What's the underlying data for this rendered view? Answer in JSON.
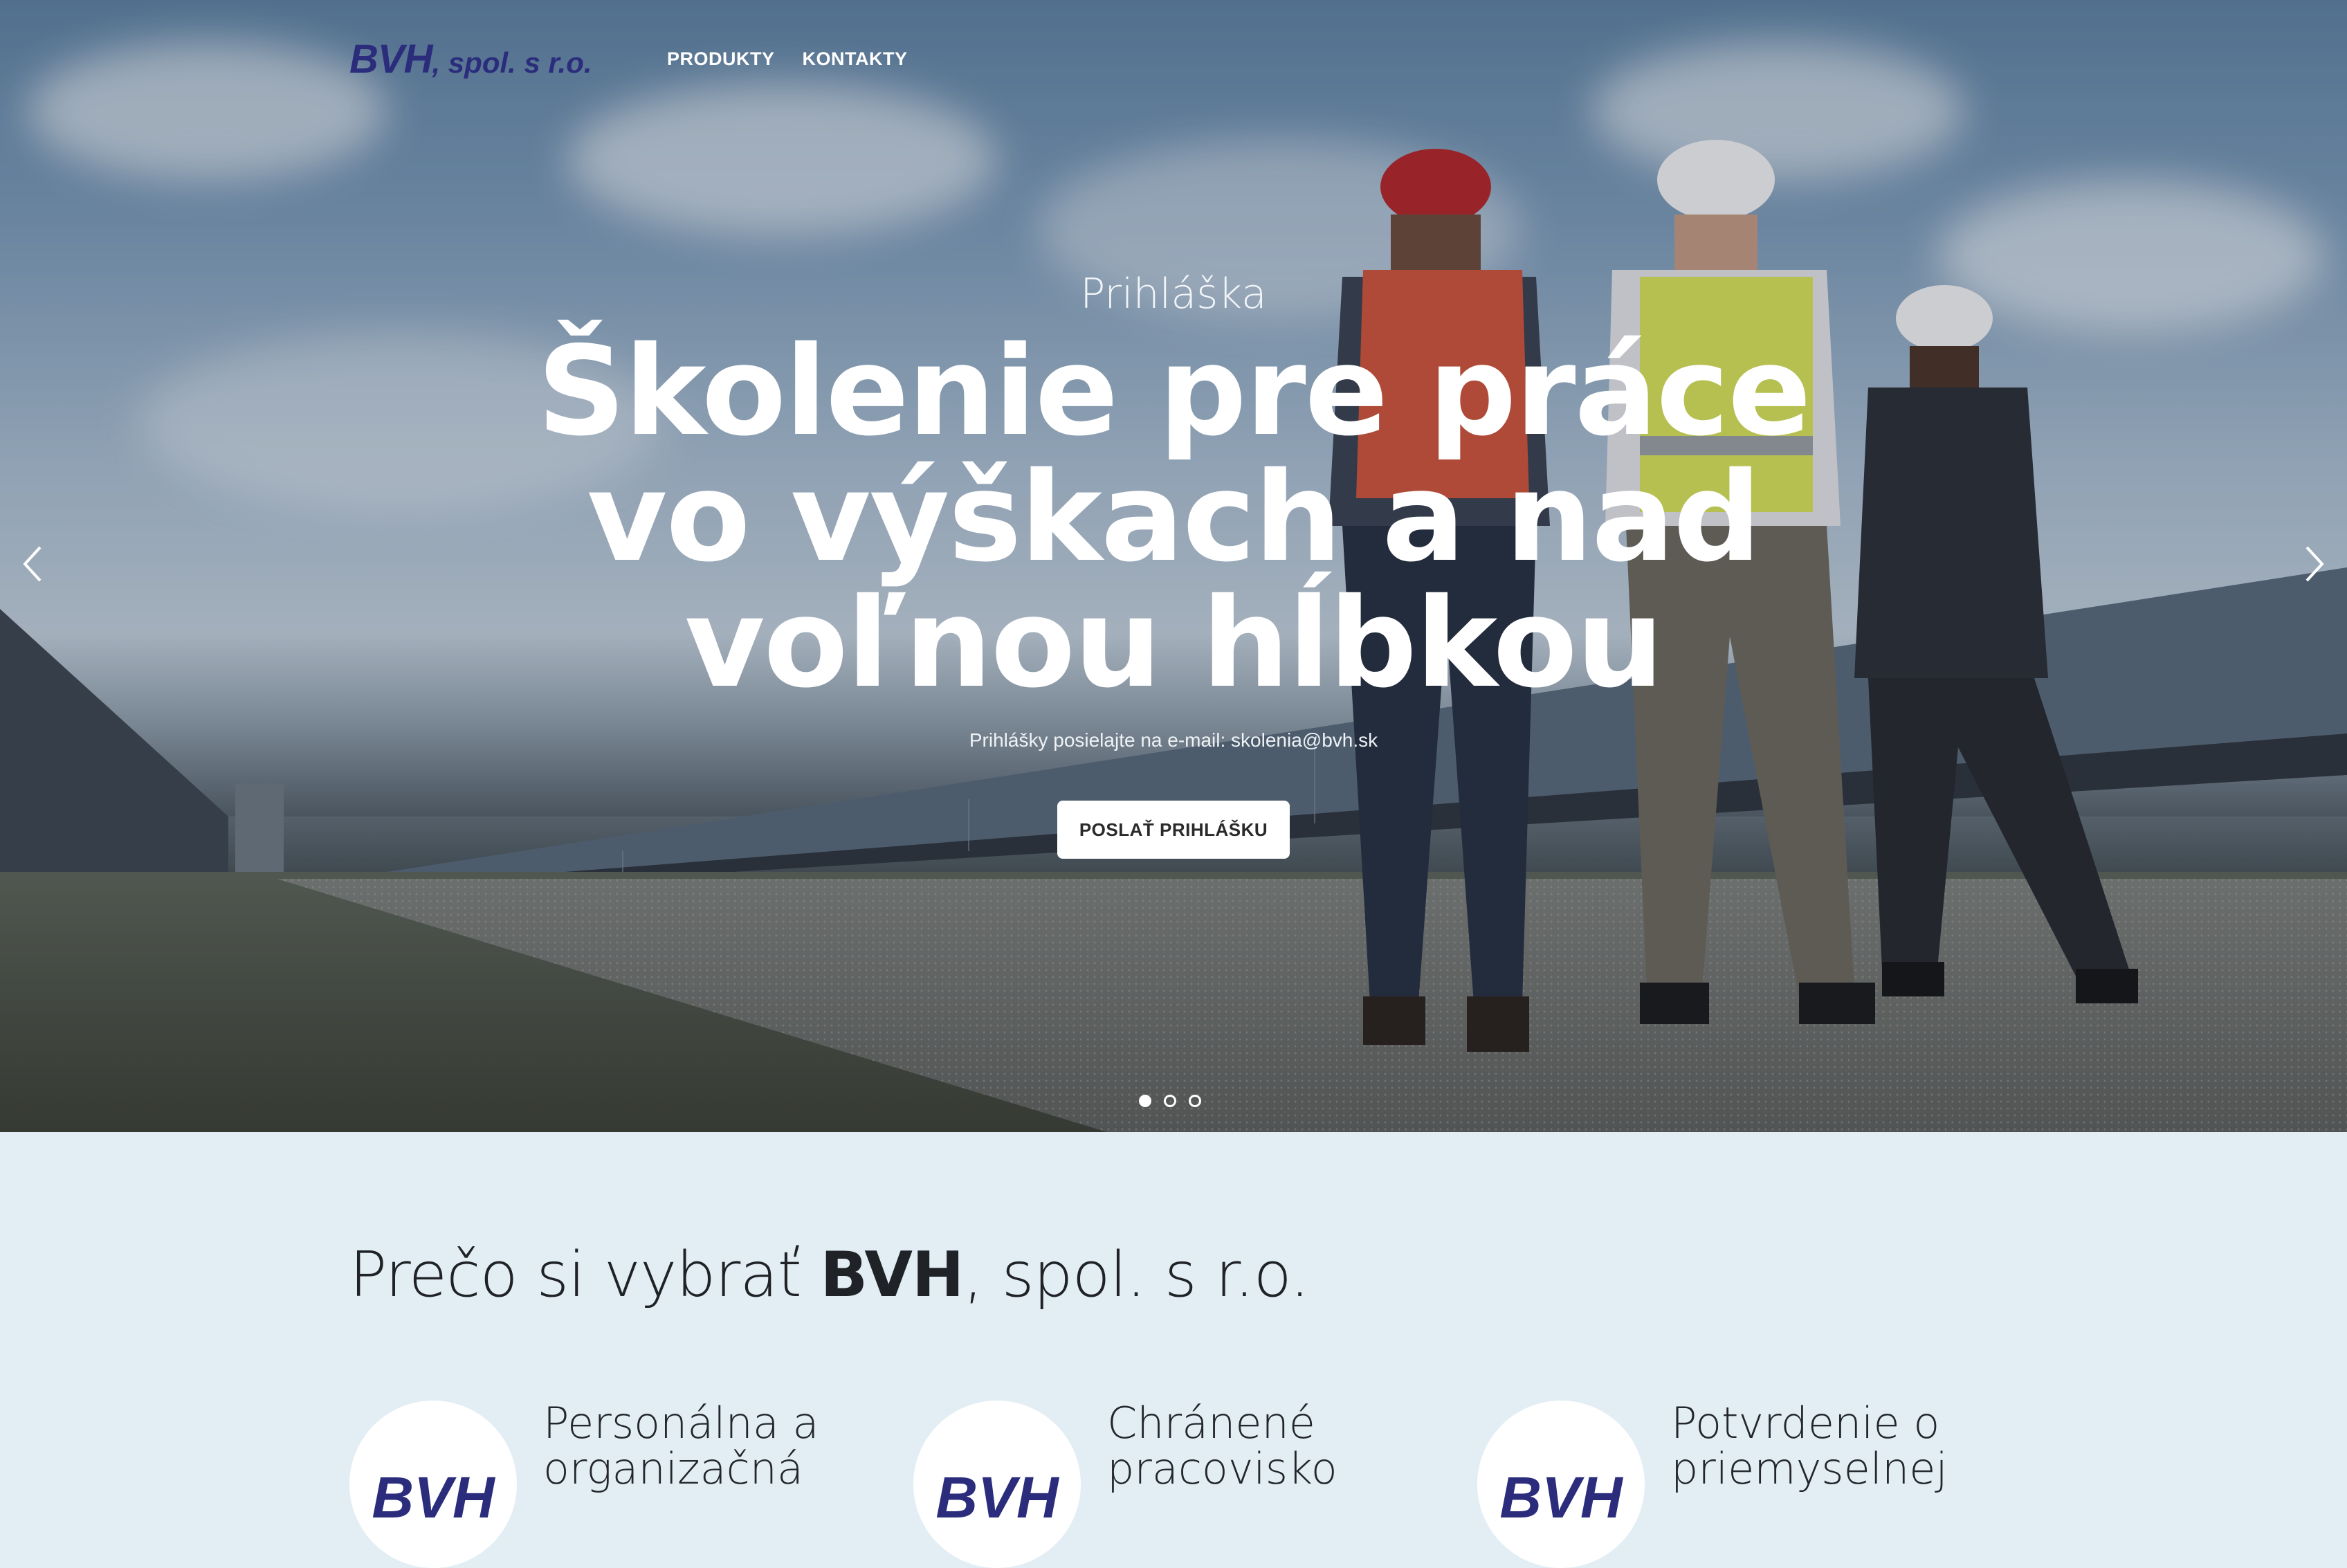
{
  "header": {
    "logo_main": "BVH",
    "logo_rest": ", spol. s r.o.",
    "nav": [
      {
        "label": "PRODUKTY"
      },
      {
        "label": "KONTAKTY"
      }
    ]
  },
  "hero": {
    "subtitle": "Prihláška",
    "title_lines": [
      "Školenie pre práce",
      "vo výškach a nad",
      "voľnou hĺbkou"
    ],
    "note": "Prihlášky posielajte na e-mail: skolenia@bvh.sk",
    "button_label": "POSLAŤ PRIHLÁŠKU",
    "slide_count": 3,
    "active_slide": 1,
    "prev_icon": "chevron-left-icon",
    "next_icon": "chevron-right-icon"
  },
  "why": {
    "prefix": "Prečo si vybrať ",
    "brand": "BVH",
    "suffix": ", spol. s r.o."
  },
  "features": [
    {
      "logo": "BVH",
      "text": "Personálna a organizačná"
    },
    {
      "logo": "BVH",
      "text": "Chránené pracovisko"
    },
    {
      "logo": "BVH",
      "text": "Potvrdenie o priemyselnej"
    }
  ],
  "colors": {
    "brand": "#2b2d7c",
    "section_bg": "#e3eef4",
    "button_bg": "#ffffff"
  }
}
